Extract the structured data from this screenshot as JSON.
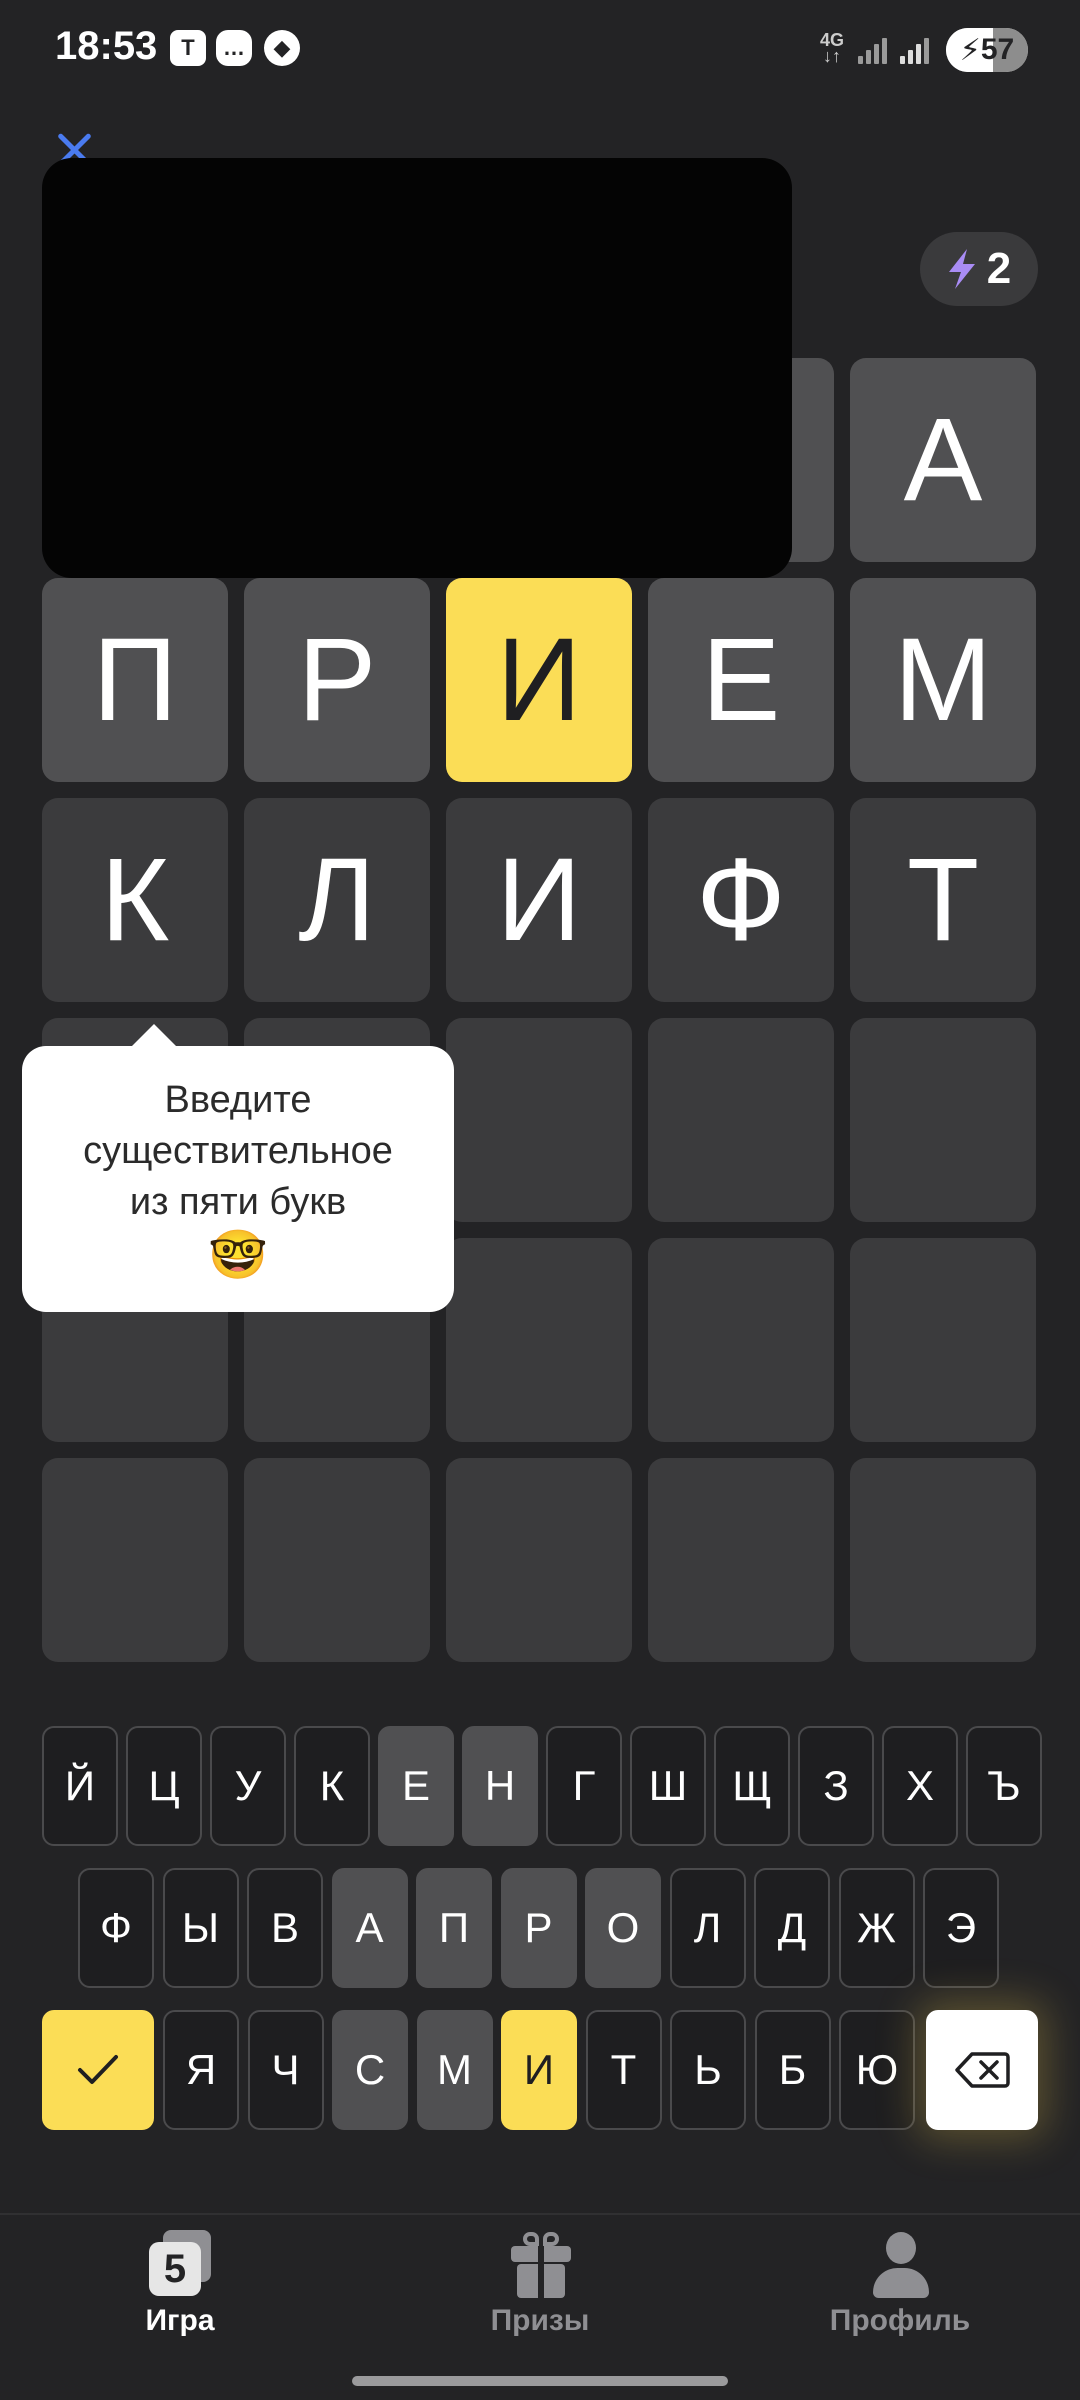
{
  "status_bar": {
    "time": "18:53",
    "notification_icons": [
      "tinkoff-icon",
      "message-icon",
      "navigation-icon"
    ],
    "network": "4G",
    "battery_level": "57",
    "battery_percent": 57
  },
  "header": {
    "close_icon": "close-icon",
    "energy_icon": "lightning-icon",
    "energy_count": "2"
  },
  "grid": {
    "rows": [
      [
        {
          "letter": "",
          "state": "hidden"
        },
        {
          "letter": "",
          "state": "hidden"
        },
        {
          "letter": "",
          "state": "hidden"
        },
        {
          "letter": "",
          "state": "absent"
        },
        {
          "letter": "А",
          "state": "absent"
        }
      ],
      [
        {
          "letter": "П",
          "state": "absent"
        },
        {
          "letter": "Р",
          "state": "absent"
        },
        {
          "letter": "И",
          "state": "present"
        },
        {
          "letter": "Е",
          "state": "absent"
        },
        {
          "letter": "М",
          "state": "absent"
        }
      ],
      [
        {
          "letter": "К",
          "state": "typed"
        },
        {
          "letter": "Л",
          "state": "typed"
        },
        {
          "letter": "И",
          "state": "typed"
        },
        {
          "letter": "Ф",
          "state": "typed"
        },
        {
          "letter": "Т",
          "state": "typed"
        }
      ],
      [
        {
          "letter": "",
          "state": "empty"
        },
        {
          "letter": "",
          "state": "empty"
        },
        {
          "letter": "",
          "state": "empty"
        },
        {
          "letter": "",
          "state": "empty"
        },
        {
          "letter": "",
          "state": "empty"
        }
      ],
      [
        {
          "letter": "",
          "state": "empty"
        },
        {
          "letter": "",
          "state": "empty"
        },
        {
          "letter": "",
          "state": "empty"
        },
        {
          "letter": "",
          "state": "empty"
        },
        {
          "letter": "",
          "state": "empty"
        }
      ],
      [
        {
          "letter": "",
          "state": "empty"
        },
        {
          "letter": "",
          "state": "empty"
        },
        {
          "letter": "",
          "state": "empty"
        },
        {
          "letter": "",
          "state": "empty"
        },
        {
          "letter": "",
          "state": "empty"
        }
      ]
    ]
  },
  "tooltip": {
    "line1": "Введите",
    "line2": "существительное",
    "line3": "из пяти букв",
    "emoji": "🤓"
  },
  "keyboard": {
    "row1": [
      {
        "label": "Й",
        "state": "default"
      },
      {
        "label": "Ц",
        "state": "default"
      },
      {
        "label": "У",
        "state": "default"
      },
      {
        "label": "К",
        "state": "default"
      },
      {
        "label": "Е",
        "state": "absent"
      },
      {
        "label": "Н",
        "state": "absent"
      },
      {
        "label": "Г",
        "state": "default"
      },
      {
        "label": "Ш",
        "state": "default"
      },
      {
        "label": "Щ",
        "state": "default"
      },
      {
        "label": "З",
        "state": "default"
      },
      {
        "label": "Х",
        "state": "default"
      },
      {
        "label": "Ъ",
        "state": "default"
      }
    ],
    "row2": [
      {
        "label": "Ф",
        "state": "default"
      },
      {
        "label": "Ы",
        "state": "default"
      },
      {
        "label": "В",
        "state": "default"
      },
      {
        "label": "А",
        "state": "absent"
      },
      {
        "label": "П",
        "state": "absent"
      },
      {
        "label": "Р",
        "state": "absent"
      },
      {
        "label": "О",
        "state": "absent"
      },
      {
        "label": "Л",
        "state": "default"
      },
      {
        "label": "Д",
        "state": "default"
      },
      {
        "label": "Ж",
        "state": "default"
      },
      {
        "label": "Э",
        "state": "default"
      }
    ],
    "row3_letters": [
      {
        "label": "Я",
        "state": "default"
      },
      {
        "label": "Ч",
        "state": "default"
      },
      {
        "label": "С",
        "state": "absent"
      },
      {
        "label": "М",
        "state": "absent"
      },
      {
        "label": "И",
        "state": "present"
      },
      {
        "label": "Т",
        "state": "default"
      },
      {
        "label": "Ь",
        "state": "default"
      },
      {
        "label": "Б",
        "state": "default"
      },
      {
        "label": "Ю",
        "state": "default"
      }
    ],
    "enter_icon": "checkmark-icon",
    "backspace_icon": "backspace-icon"
  },
  "bottom_nav": {
    "items": [
      {
        "label": "Игра",
        "icon": "game-icon",
        "active": true
      },
      {
        "label": "Призы",
        "icon": "gift-icon",
        "active": false
      },
      {
        "label": "Профиль",
        "icon": "profile-icon",
        "active": false
      }
    ]
  },
  "colors": {
    "background": "#232325",
    "tile_absent": "#505052",
    "tile_present": "#fbdd56",
    "tile_empty": "#3b3b3d",
    "accent_close": "#4a7bf0",
    "energy_bolt": "#a98cf5"
  }
}
